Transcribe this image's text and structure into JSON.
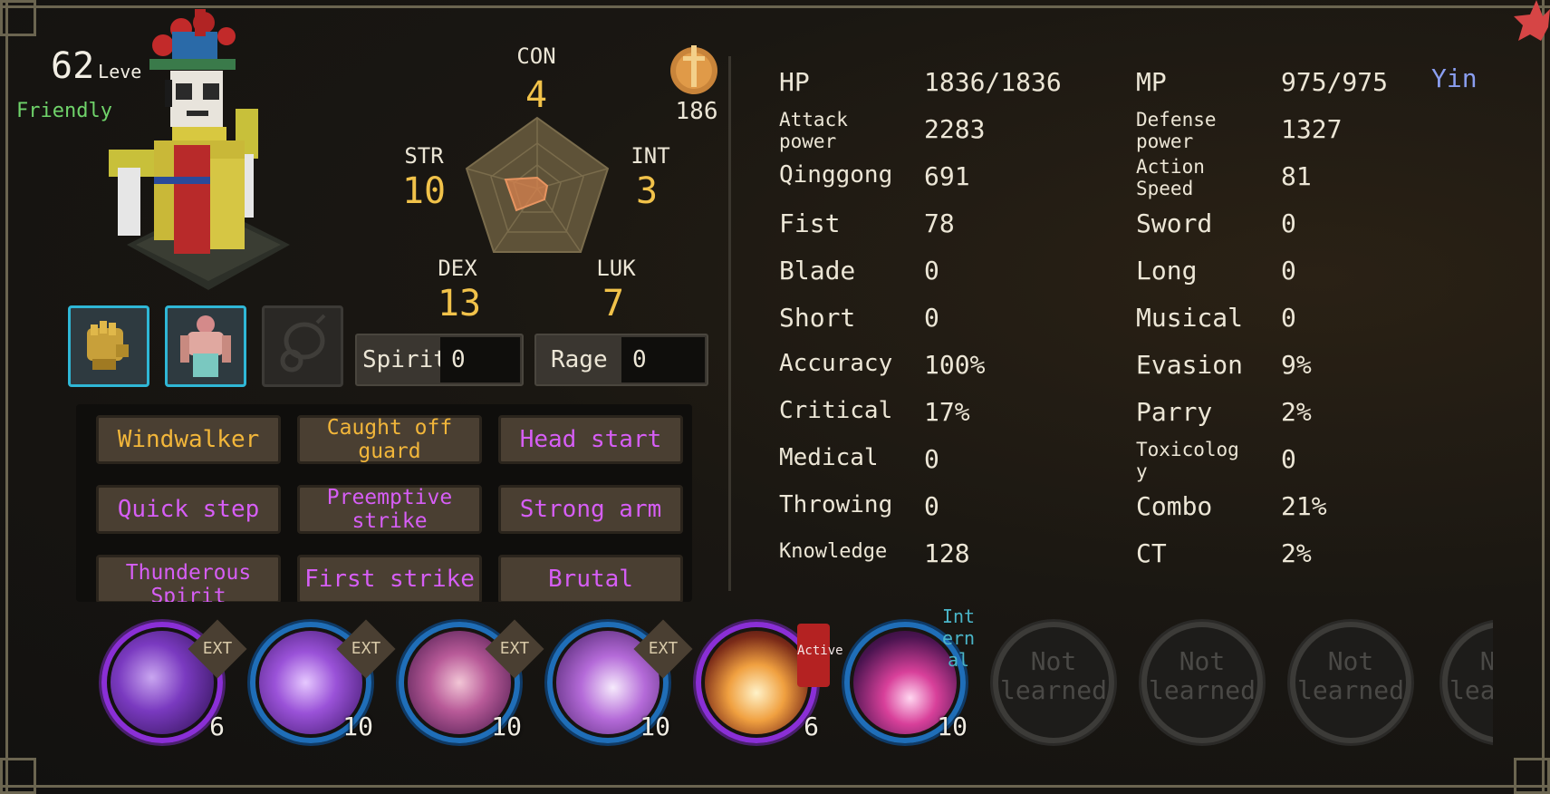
{
  "character": {
    "level": "62",
    "level_label": "Leve",
    "disposition": "Friendly",
    "medal_value": "186"
  },
  "attributes": {
    "con": {
      "label": "CON",
      "value": "4"
    },
    "str": {
      "label": "STR",
      "value": "10"
    },
    "int": {
      "label": "INT",
      "value": "3"
    },
    "dex": {
      "label": "DEX",
      "value": "13"
    },
    "luk": {
      "label": "LUK",
      "value": "7"
    }
  },
  "bars": {
    "spirit": {
      "label": "Spirit",
      "value": "0"
    },
    "rage": {
      "label": "Rage",
      "value": "0"
    }
  },
  "traits": [
    {
      "label": "Windwalker",
      "color": "gold"
    },
    {
      "label": "Caught off guard",
      "color": "gold"
    },
    {
      "label": "Head start",
      "color": "purple"
    },
    {
      "label": "Quick step",
      "color": "purple"
    },
    {
      "label": "Preemptive strike",
      "color": "purple"
    },
    {
      "label": "Strong arm",
      "color": "purple"
    },
    {
      "label": "Thunderous Spirit",
      "color": "purple"
    },
    {
      "label": "First strike",
      "color": "purple"
    },
    {
      "label": "Brutal",
      "color": "purple"
    }
  ],
  "stats_left": [
    {
      "label": "HP",
      "value": "1836/1836"
    },
    {
      "label": "Attack power",
      "value": "2283"
    },
    {
      "label": "Qinggong",
      "value": "691"
    },
    {
      "label": "Fist",
      "value": "78"
    },
    {
      "label": "Blade",
      "value": "0"
    },
    {
      "label": "Short",
      "value": "0"
    },
    {
      "label": "Accuracy",
      "value": "100%"
    },
    {
      "label": "Critical",
      "value": "17%"
    },
    {
      "label": "Medical",
      "value": "0"
    },
    {
      "label": "Throwing",
      "value": "0"
    },
    {
      "label": "Knowledge",
      "value": "128"
    }
  ],
  "stats_right": [
    {
      "label": "MP",
      "value": "975/975"
    },
    {
      "label": "Defense power",
      "value": "1327"
    },
    {
      "label": "Action Speed",
      "value": "81"
    },
    {
      "label": "Sword",
      "value": "0"
    },
    {
      "label": "Long",
      "value": "0"
    },
    {
      "label": "Musical",
      "value": "0"
    },
    {
      "label": "Evasion",
      "value": "9%"
    },
    {
      "label": "Parry",
      "value": "2%"
    },
    {
      "label": "Toxicology",
      "value": "0"
    },
    {
      "label": "Combo",
      "value": "21%"
    },
    {
      "label": "CT",
      "value": "2%"
    }
  ],
  "affinity": "Yin",
  "skills": [
    {
      "level": "6",
      "tag": "EXT",
      "ring": "purple"
    },
    {
      "level": "10",
      "tag": "EXT",
      "ring": "blue"
    },
    {
      "level": "10",
      "tag": "EXT",
      "ring": "blue"
    },
    {
      "level": "10",
      "tag": "EXT",
      "ring": "blue"
    },
    {
      "level": "6",
      "tag": "Active",
      "ring": "purple"
    },
    {
      "level": "10",
      "tag": "Internal",
      "ring": "blue"
    },
    {
      "empty_label": "Not learned"
    },
    {
      "empty_label": "Not learned"
    },
    {
      "empty_label": "Not learned"
    },
    {
      "empty_label": "Not learned"
    }
  ],
  "colors": {
    "gold_text": "#f1c24a",
    "purple_trait": "#d65ef5",
    "gold_trait": "#f2b63a",
    "friendly": "#6fd36a",
    "yin": "#8a9ef0",
    "equip_border": "#2fb7d6"
  },
  "icons": [
    "gauntlet-icon",
    "robe-icon",
    "pendant-slot-icon",
    "sword-medal-icon",
    "radar-chart",
    "close-star-icon"
  ]
}
